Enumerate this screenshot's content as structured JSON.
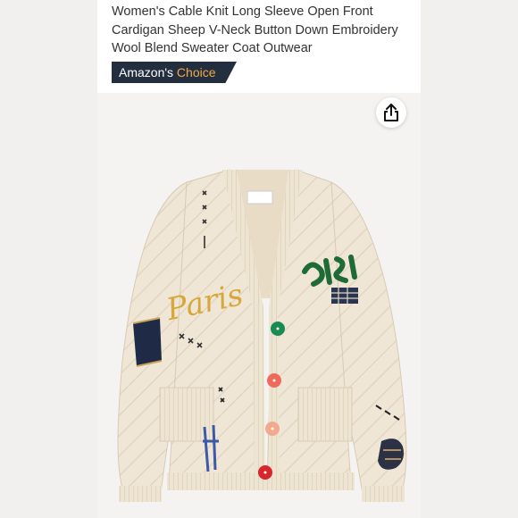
{
  "product": {
    "title": "Women's Cable Knit Long Sleeve Open Front Cardigan Sheep V-Neck Button Down Embroidery Wool Blend Sweater Coat Outwear",
    "badge": {
      "prefix": "Amazon's",
      "highlight": "Choice"
    },
    "image_alt_icon": "cardigan-product-image",
    "share_icon": "share-icon",
    "colors": {
      "badge_bg": "#232f3e",
      "badge_accent": "#f3a847",
      "garment": "#efe6d6"
    },
    "garment_label": "Paris"
  }
}
